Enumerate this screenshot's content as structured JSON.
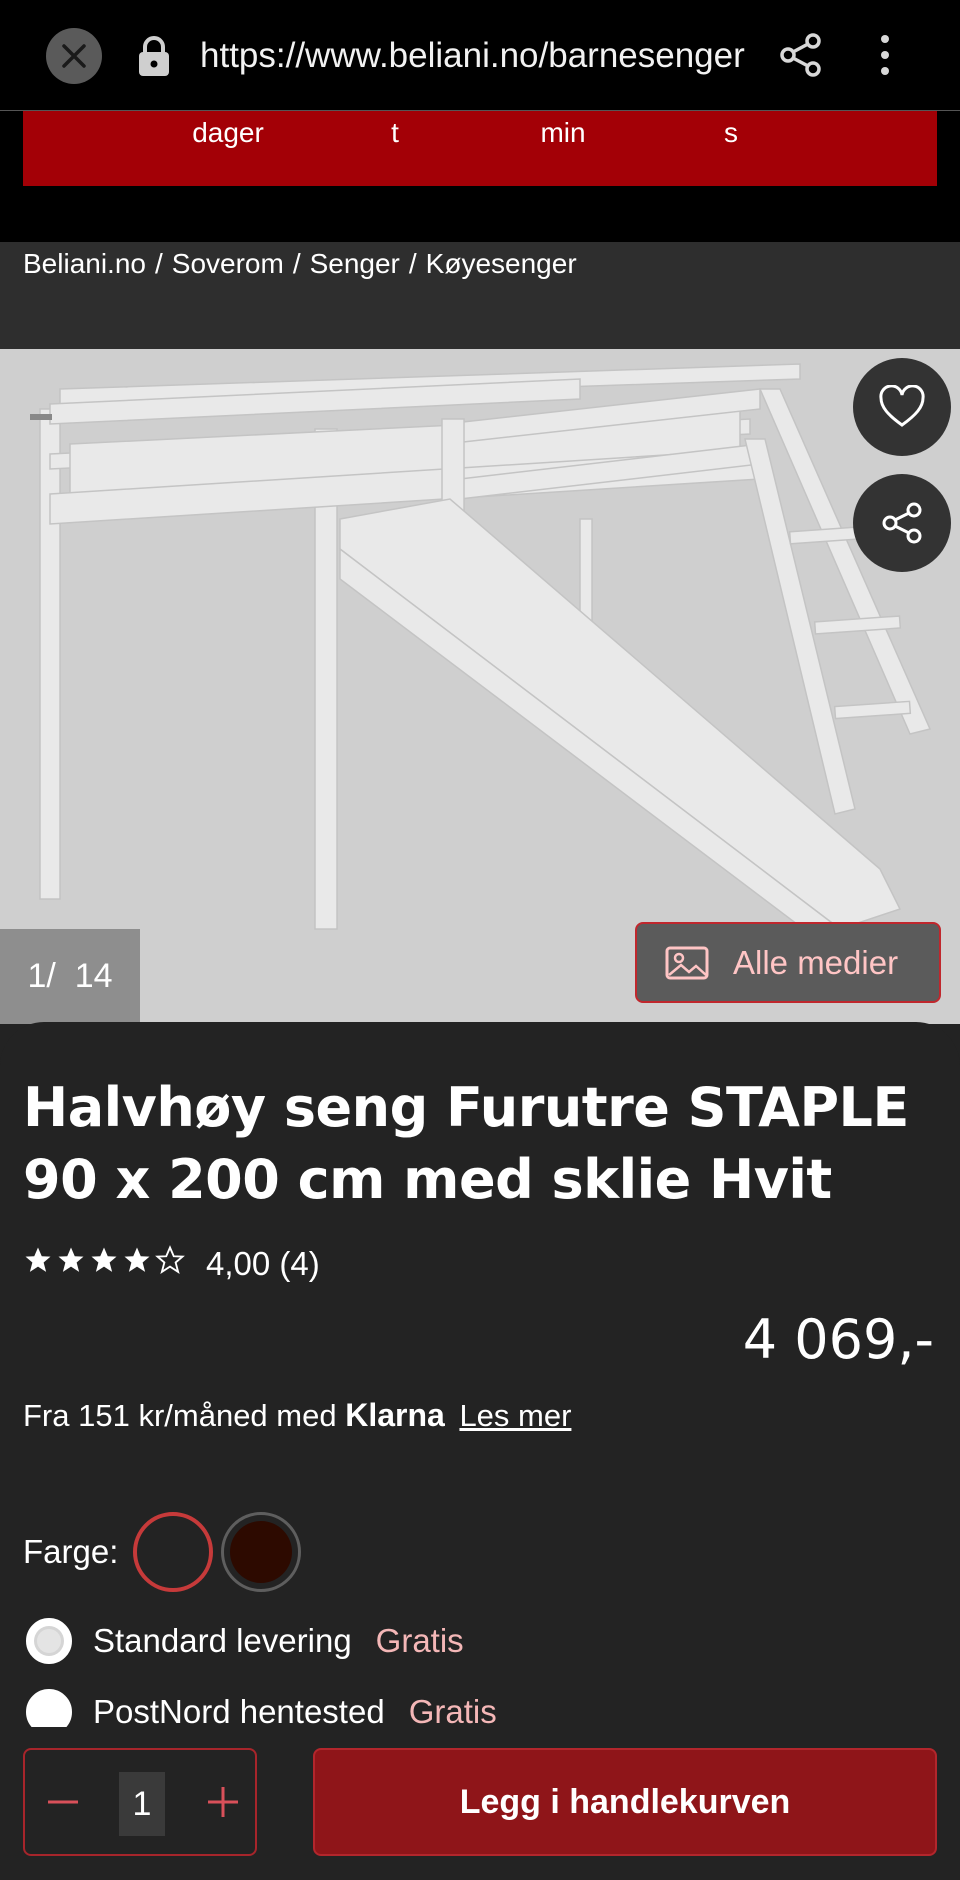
{
  "browser": {
    "url": "https://www.beliani.no/barnesenger",
    "close_icon": "close-icon",
    "lock_icon": "lock-icon",
    "share_icon": "share-icon",
    "menu_icon": "more-vert-icon"
  },
  "countdown": {
    "labels": [
      "dager",
      "t",
      "min",
      "s"
    ],
    "bg_color": "#a30006"
  },
  "breadcrumb": [
    "Beliani.no",
    "Soverom",
    "Senger",
    "Køyesenger"
  ],
  "gallery": {
    "counter_current": "1",
    "counter_sep": "/",
    "counter_total": "14",
    "media_button_label": "Alle medier",
    "favorite_icon": "heart-icon",
    "share_icon": "share-icon",
    "image_icon": "image-icon"
  },
  "product": {
    "title": "Halvhøy seng Furutre STAPLE 90 x 200 cm med sklie Hvit",
    "rating_value": 4.0,
    "rating_text": "4,00 (4)",
    "price": "4 069,-",
    "klarna_prefix": "Fra 151 kr/måned med",
    "klarna_brand": "Klarna",
    "klarna_link": "Les mer"
  },
  "color": {
    "label": "Farge:",
    "swatches": [
      "#232323",
      "#2d0a00"
    ],
    "selected_index": 0
  },
  "shipping": [
    {
      "name": "Standard levering",
      "price": "Gratis",
      "selected": true
    },
    {
      "name": "PostNord hentested",
      "price": "Gratis",
      "selected": false
    }
  ],
  "cart": {
    "quantity": "1",
    "minus_icon": "minus-icon",
    "plus_icon": "plus-icon",
    "add_label": "Legg i handlekurven",
    "accent": "#8f1519"
  }
}
